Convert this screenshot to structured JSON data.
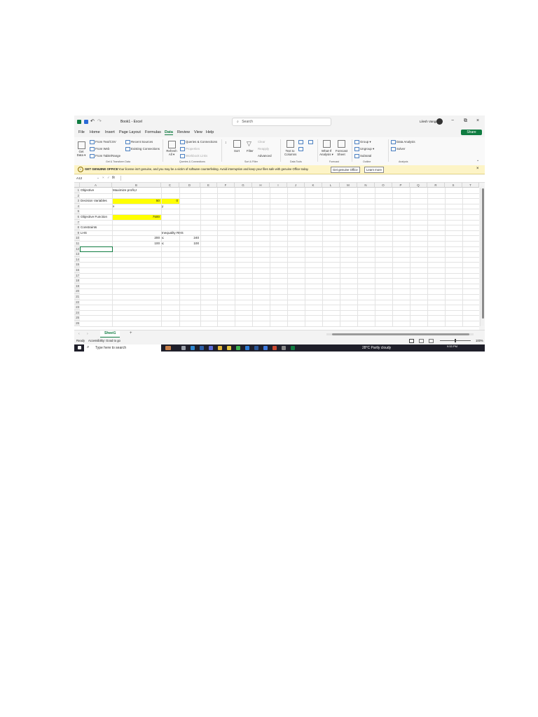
{
  "titlebar": {
    "title": "Book1 - Excel",
    "search_placeholder": "Search",
    "user": "Lilesh Vangal",
    "minimize": "−",
    "restore": "⧉",
    "close": "×",
    "undo": "↶",
    "redo": "↷"
  },
  "menu": {
    "items": [
      "File",
      "Home",
      "Insert",
      "Page Layout",
      "Formulas",
      "Data",
      "Review",
      "View",
      "Help"
    ],
    "active": "Data",
    "share": "Share"
  },
  "ribbon": {
    "get_data": "Get Data ▾",
    "from_text": "From Text/CSV",
    "from_web": "From Web",
    "from_table": "From Table/Range",
    "recent_sources": "Recent Sources",
    "existing_connections": "Existing Connections",
    "group_get_transform": "Get & Transform Data",
    "refresh_all": "Refresh All ▾",
    "queries_connections": "Queries & Connections",
    "properties": "Properties",
    "workbook_links": "Workbook Links",
    "group_queries": "Queries & Connections",
    "sort": "Sort",
    "filter": "Filter",
    "clear": "Clear",
    "reapply": "Reapply",
    "advanced": "Advanced",
    "group_sort_filter": "Sort & Filter",
    "text_to_columns": "Text to Columns",
    "group_data_tools": "Data Tools",
    "what_if": "What-If Analysis ▾",
    "forecast_sheet": "Forecast Sheet",
    "group_forecast": "Forecast",
    "group_btn": "Group ▾",
    "ungroup_btn": "Ungroup ▾",
    "subtotal": "Subtotal",
    "group_outline": "Outline",
    "data_analysis": "Data Analysis",
    "solver": "Solver",
    "group_analysis": "Analysis"
  },
  "notification": {
    "label": "GET GENUINE OFFICE",
    "message": "Your license isn't genuine, and you may be a victim of software counterfeiting. Avoid interruption and keep your files safe with genuine Office today.",
    "btn_genuine": "Get genuine Office",
    "btn_learn": "Learn more",
    "close": "×"
  },
  "formula_bar": {
    "name_box": "A12",
    "fx": "fx",
    "value": ""
  },
  "grid": {
    "columns": [
      "A",
      "B",
      "C",
      "D",
      "E",
      "F",
      "G",
      "H",
      "I",
      "J",
      "K",
      "L",
      "M",
      "N",
      "O",
      "P",
      "Q",
      "R",
      "S",
      "T"
    ],
    "rows": [
      "1",
      "2",
      "3",
      "4",
      "5",
      "6",
      "7",
      "8",
      "9",
      "10",
      "11",
      "12",
      "13",
      "14",
      "15",
      "16",
      "17",
      "18",
      "19",
      "20",
      "21",
      "22",
      "23",
      "24",
      "25",
      "26"
    ],
    "cells": {
      "A1": "Objective",
      "B1": "Maximize profit,z",
      "A3": "Decision Variables",
      "B3": "50",
      "C3": "0",
      "B4": "x",
      "C4": "y",
      "A6": "Objective Function",
      "B6": "7500",
      "A8": "Constraints",
      "A9": "LHS",
      "C9": "Inequality RHS",
      "B10": "200",
      "C10": "≤",
      "D10": "240",
      "B11": "100",
      "C11": "≤",
      "D11": "100"
    }
  },
  "sheet_tabs": {
    "tabs": [
      "Sheet1"
    ],
    "add": "+"
  },
  "status": {
    "ready": "Ready",
    "accessibility": "Accessibility: Good to go",
    "zoom": "100%"
  },
  "taskbar": {
    "search_placeholder": "Type here to search",
    "weather": "28°C  Partly cloudy",
    "time": "9:53 PM"
  },
  "colors": {
    "excel_green": "#107c41",
    "highlight_yellow": "#ffff00",
    "notification_bg": "#fdf4c6",
    "taskbar_bg": "#1f1f2a"
  }
}
